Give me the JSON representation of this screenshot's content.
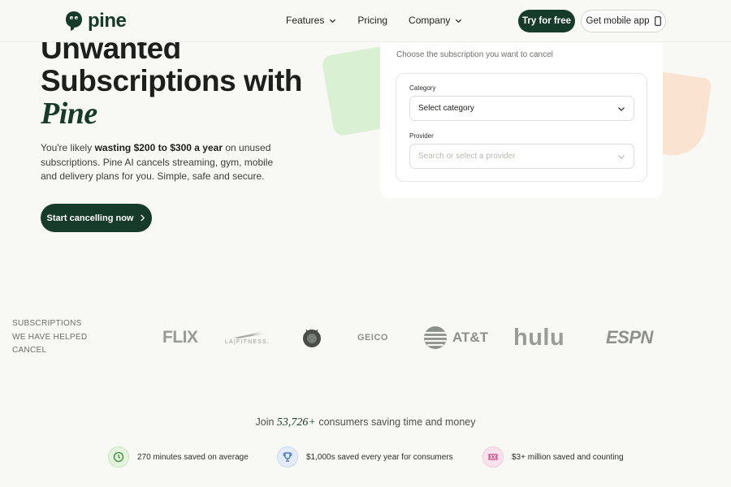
{
  "header": {
    "logo_text": "pine",
    "nav": [
      {
        "label": "Features",
        "has_dropdown": true
      },
      {
        "label": "Pricing",
        "has_dropdown": false
      },
      {
        "label": "Company",
        "has_dropdown": true
      }
    ],
    "try_label": "Try for free",
    "mobile_label": "Get mobile app"
  },
  "hero": {
    "title_line1": "Unwanted",
    "title_line2": "Subscriptions with",
    "title_line3": "Pine",
    "desc_pre": "You're likely ",
    "desc_bold": "wasting $200 to $300 a year",
    "desc_post": " on unused subscriptions. Pine AI cancels streaming, gym, mobile and delivery plans for you. Simple, safe and secure.",
    "cta_label": "Start cancelling now"
  },
  "form": {
    "prompt": "Choose the subscription you want to cancel",
    "category_label": "Category",
    "category_value": "Select category",
    "provider_label": "Provider",
    "provider_placeholder": "Search or select a provider"
  },
  "brands": {
    "label_line1": "SUBSCRIPTIONS",
    "label_line2": "WE HAVE HELPED",
    "label_line3": "CANCEL",
    "netflix": "FLIX",
    "lafitness": "LA|FITNESS.",
    "geico": "GEICO",
    "att": "AT&T",
    "hulu": "hulu",
    "espn": "ESPN"
  },
  "stats": {
    "join_pre": "Join ",
    "join_num": "53,726+",
    "join_post": " consumers saving time and money",
    "items": [
      {
        "label": "270 minutes saved on average",
        "icon": "clock-icon"
      },
      {
        "label": "$1,000s saved every year for consumers",
        "icon": "trophy-icon"
      },
      {
        "label": "$3+ million saved and counting",
        "icon": "ticket-icon"
      }
    ]
  },
  "colors": {
    "brand_green": "#173b2b",
    "background": "#f8f8f4"
  }
}
